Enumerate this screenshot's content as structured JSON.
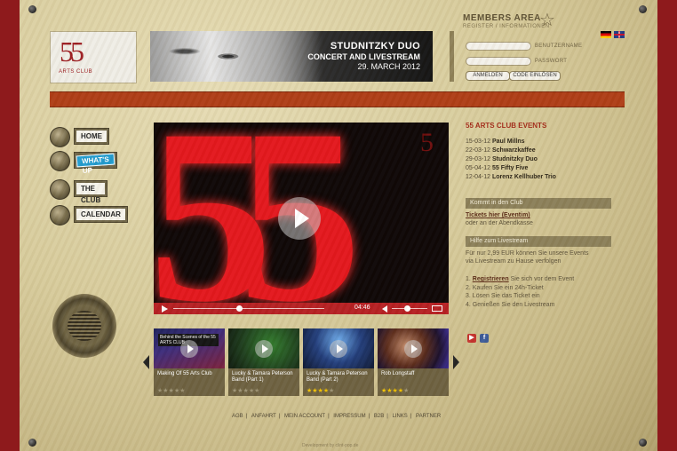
{
  "logo": {
    "number": "55",
    "subtitle": "ARTS CLUB"
  },
  "banner": {
    "title": "STUDNITZKY DUO",
    "subtitle": "CONCERT AND LIVESTREAM",
    "date": "29. MARCH 2012"
  },
  "members": {
    "title": "MEMBERS AREA",
    "subtitle": "REGISTER / INFORMATIONEN",
    "username_label": "BENUTZERNAME",
    "password_label": "PASSWORT",
    "login_button": "ANMELDEN",
    "code_button": "CODE EINLÖSEN"
  },
  "languages": [
    "de",
    "en"
  ],
  "nav": [
    {
      "label": "HOME"
    },
    {
      "label": "WHAT'S UP"
    },
    {
      "label": "THE CLUB"
    },
    {
      "label": "CALENDAR"
    }
  ],
  "video": {
    "time": "04:46",
    "progress": 0.45
  },
  "thumbnails": [
    {
      "caption": "Making Of 55 Arts Club",
      "overlay": "Behind the Scenes of the 55 ARTS CLUB",
      "rating": 0
    },
    {
      "caption": "Lucky & Tamara Peterson Band (Part 1)",
      "rating": 0
    },
    {
      "caption": "Lucky & Tamara Peterson Band (Part 2)",
      "rating": 4
    },
    {
      "caption": "Rob Longstaff",
      "rating": 4
    }
  ],
  "events": {
    "title": "55 ARTS CLUB EVENTS",
    "items": [
      {
        "date": "15-03-12",
        "name": "Paul Millns"
      },
      {
        "date": "22-03-12",
        "name": "Schwarzkaffee"
      },
      {
        "date": "29-03-12",
        "name": "Studnitzky Duo"
      },
      {
        "date": "05-04-12",
        "name": "55 Fifty Five"
      },
      {
        "date": "12-04-12",
        "name": "Lorenz Kellhuber Trio"
      }
    ]
  },
  "club_info": {
    "bar": "Kommt in den Club",
    "link": "Tickets hier (Eventim)",
    "text": "oder an der Abendkasse"
  },
  "livestream": {
    "bar": "Hilfe zum Livestream",
    "text_1": "Für nur 2,99 EUR können Sie unsere Events",
    "text_2": "via Livestream zu Hause verfolgen",
    "steps": [
      {
        "num": "1.",
        "link": "Registrieren",
        "text": "Sie sich vor dem Event"
      },
      {
        "num": "2.",
        "text": "Kaufen Sie ein 24h-Ticket"
      },
      {
        "num": "3.",
        "text": "Lösen Sie das Ticket ein"
      },
      {
        "num": "4.",
        "text": "Genießen Sie den Livestream"
      }
    ]
  },
  "footer": {
    "links": [
      "AGB",
      "ANFAHRT",
      "MEIN ACCOUNT",
      "IMPRESSUM",
      "B2B",
      "LINKS",
      "PARTNER"
    ],
    "credit": "Development by clint-pop.de"
  },
  "colors": {
    "frame_red": "#8e1a1c",
    "accent_red": "#ae3b14",
    "video_red": "#e3141a",
    "bar_olive": "#8a7e57"
  }
}
